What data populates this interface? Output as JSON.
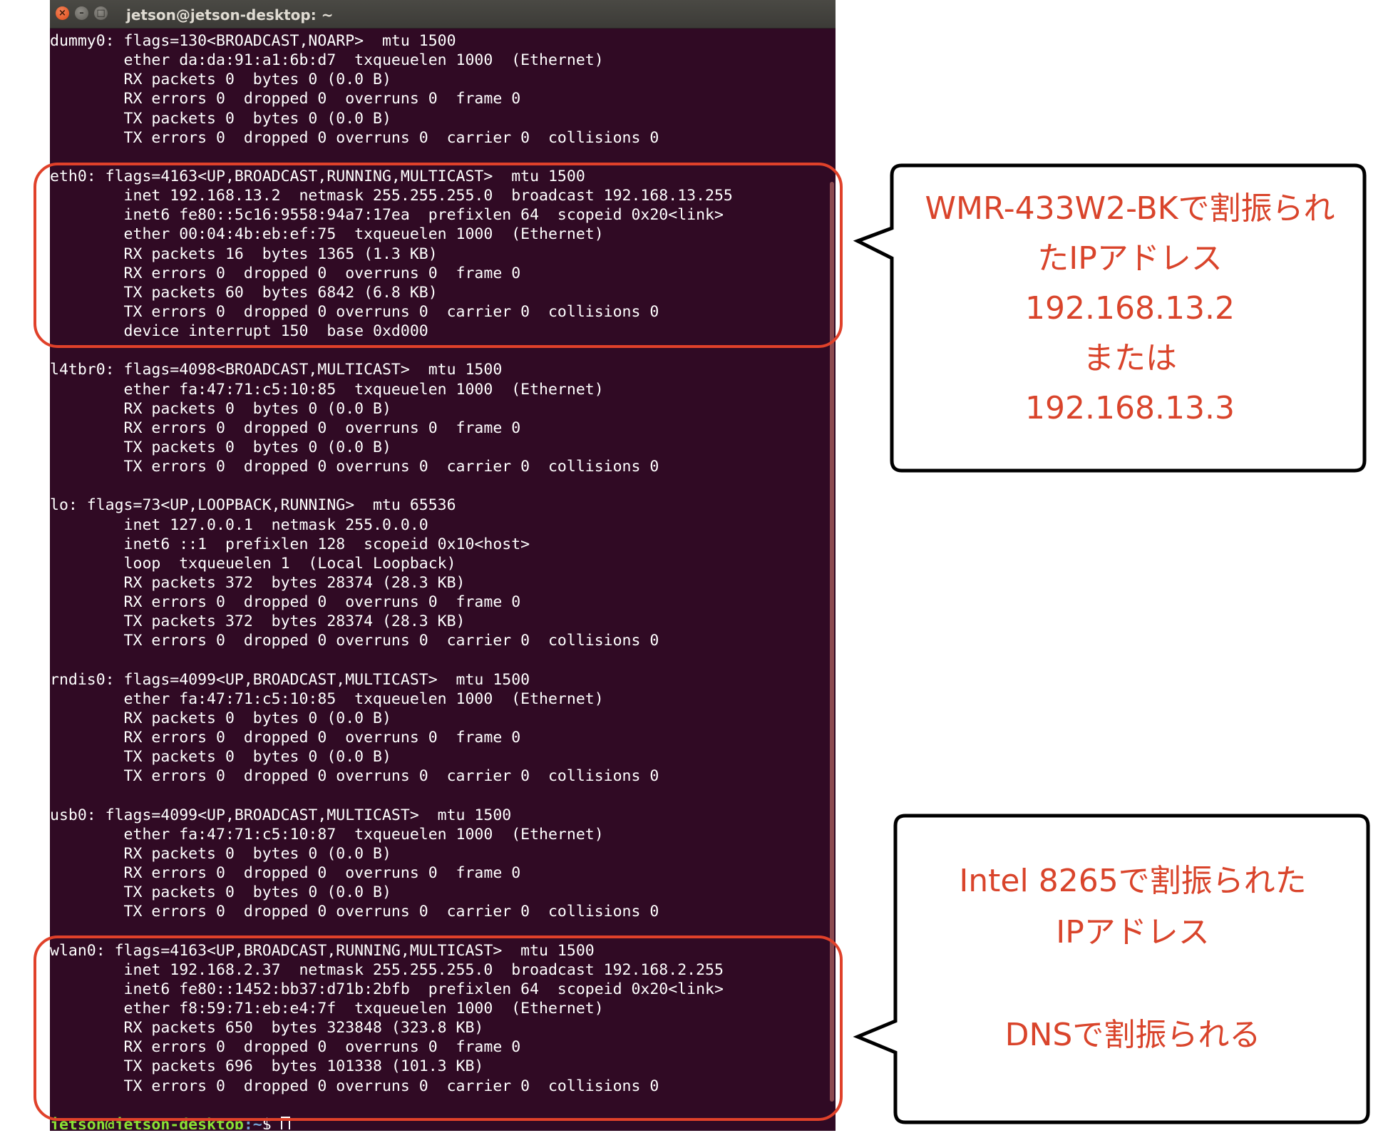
{
  "window": {
    "title": "jetson@jetson-desktop: ~",
    "buttons": {
      "close": "×",
      "minimize": "–",
      "maximize": "□"
    }
  },
  "terminal": {
    "lines": [
      "dummy0: flags=130<BROADCAST,NOARP>  mtu 1500",
      "        ether da:da:91:a1:6b:d7  txqueuelen 1000  (Ethernet)",
      "        RX packets 0  bytes 0 (0.0 B)",
      "        RX errors 0  dropped 0  overruns 0  frame 0",
      "        TX packets 0  bytes 0 (0.0 B)",
      "        TX errors 0  dropped 0 overruns 0  carrier 0  collisions 0",
      "",
      "eth0: flags=4163<UP,BROADCAST,RUNNING,MULTICAST>  mtu 1500",
      "        inet 192.168.13.2  netmask 255.255.255.0  broadcast 192.168.13.255",
      "        inet6 fe80::5c16:9558:94a7:17ea  prefixlen 64  scopeid 0x20<link>",
      "        ether 00:04:4b:eb:ef:75  txqueuelen 1000  (Ethernet)",
      "        RX packets 16  bytes 1365 (1.3 KB)",
      "        RX errors 0  dropped 0  overruns 0  frame 0",
      "        TX packets 60  bytes 6842 (6.8 KB)",
      "        TX errors 0  dropped 0 overruns 0  carrier 0  collisions 0",
      "        device interrupt 150  base 0xd000",
      "",
      "l4tbr0: flags=4098<BROADCAST,MULTICAST>  mtu 1500",
      "        ether fa:47:71:c5:10:85  txqueuelen 1000  (Ethernet)",
      "        RX packets 0  bytes 0 (0.0 B)",
      "        RX errors 0  dropped 0  overruns 0  frame 0",
      "        TX packets 0  bytes 0 (0.0 B)",
      "        TX errors 0  dropped 0 overruns 0  carrier 0  collisions 0",
      "",
      "lo: flags=73<UP,LOOPBACK,RUNNING>  mtu 65536",
      "        inet 127.0.0.1  netmask 255.0.0.0",
      "        inet6 ::1  prefixlen 128  scopeid 0x10<host>",
      "        loop  txqueuelen 1  (Local Loopback)",
      "        RX packets 372  bytes 28374 (28.3 KB)",
      "        RX errors 0  dropped 0  overruns 0  frame 0",
      "        TX packets 372  bytes 28374 (28.3 KB)",
      "        TX errors 0  dropped 0 overruns 0  carrier 0  collisions 0",
      "",
      "rndis0: flags=4099<UP,BROADCAST,MULTICAST>  mtu 1500",
      "        ether fa:47:71:c5:10:85  txqueuelen 1000  (Ethernet)",
      "        RX packets 0  bytes 0 (0.0 B)",
      "        RX errors 0  dropped 0  overruns 0  frame 0",
      "        TX packets 0  bytes 0 (0.0 B)",
      "        TX errors 0  dropped 0 overruns 0  carrier 0  collisions 0",
      "",
      "usb0: flags=4099<UP,BROADCAST,MULTICAST>  mtu 1500",
      "        ether fa:47:71:c5:10:87  txqueuelen 1000  (Ethernet)",
      "        RX packets 0  bytes 0 (0.0 B)",
      "        RX errors 0  dropped 0  overruns 0  frame 0",
      "        TX packets 0  bytes 0 (0.0 B)",
      "        TX errors 0  dropped 0 overruns 0  carrier 0  collisions 0",
      "",
      "wlan0: flags=4163<UP,BROADCAST,RUNNING,MULTICAST>  mtu 1500",
      "        inet 192.168.2.37  netmask 255.255.255.0  broadcast 192.168.2.255",
      "        inet6 fe80::1452:bb37:d71b:2bfb  prefixlen 64  scopeid 0x20<link>",
      "        ether f8:59:71:eb:e4:7f  txqueuelen 1000  (Ethernet)",
      "        RX packets 650  bytes 323848 (323.8 KB)",
      "        RX errors 0  dropped 0  overruns 0  frame 0",
      "        TX packets 696  bytes 101338 (101.3 KB)",
      "        TX errors 0  dropped 0 overruns 0  carrier 0  collisions 0",
      ""
    ],
    "prompt": {
      "user_host": "jetson@jetson-desktop",
      "path": ":~",
      "symbol": "$ "
    }
  },
  "callouts": {
    "eth0": {
      "lines": [
        "WMR-433W2-BKで割振られ",
        "たIPアドレス",
        "192.168.13.2",
        "または",
        "192.168.13.3"
      ]
    },
    "wlan0": {
      "lines": [
        "Intel 8265で割振られた",
        "IPアドレス",
        "",
        "DNSで割振られる"
      ]
    }
  },
  "colors": {
    "terminal_bg": "#300a24",
    "terminal_fg": "#ffffff",
    "prompt_user": "#8ae234",
    "prompt_path": "#729fcf",
    "annotation": "#e0412a",
    "callout_text": "#d9442b"
  }
}
